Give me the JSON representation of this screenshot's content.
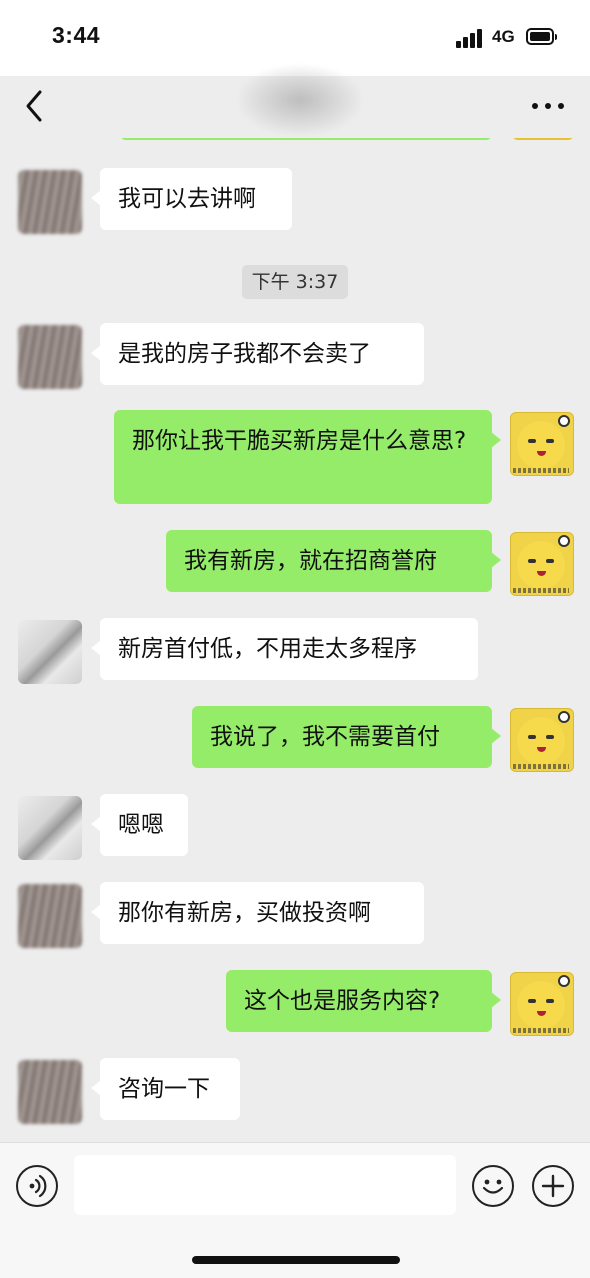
{
  "status_bar": {
    "time": "3:44",
    "network": "4G",
    "icons": [
      "signal-icon",
      "battery-icon"
    ]
  },
  "nav": {
    "back_icon": "chevron-left-icon",
    "more_icon": "more-dots-icon"
  },
  "chat": {
    "timestamp": "下午 3:37",
    "messages": [
      {
        "side": "left",
        "text": "我可以去讲啊"
      },
      {
        "side": "left",
        "text": "是我的房子我都不会卖了"
      },
      {
        "side": "right",
        "text": "那你让我干脆买新房是什么意思?"
      },
      {
        "side": "right",
        "text": "我有新房，就在招商誉府"
      },
      {
        "side": "left",
        "text": "新房首付低，不用走太多程序"
      },
      {
        "side": "right",
        "text": "我说了，我不需要首付"
      },
      {
        "side": "left",
        "text": "嗯嗯"
      },
      {
        "side": "left",
        "text": "那你有新房，买做投资啊"
      },
      {
        "side": "right",
        "text": "这个也是服务内容?"
      },
      {
        "side": "left",
        "text": "咨询一下"
      }
    ]
  },
  "input_bar": {
    "voice_icon": "voice-icon",
    "emoji_icon": "emoji-icon",
    "plus_icon": "plus-icon",
    "input_value": ""
  },
  "colors": {
    "background": "#ededed",
    "sent_bubble": "#95ec69",
    "received_bubble": "#ffffff"
  }
}
